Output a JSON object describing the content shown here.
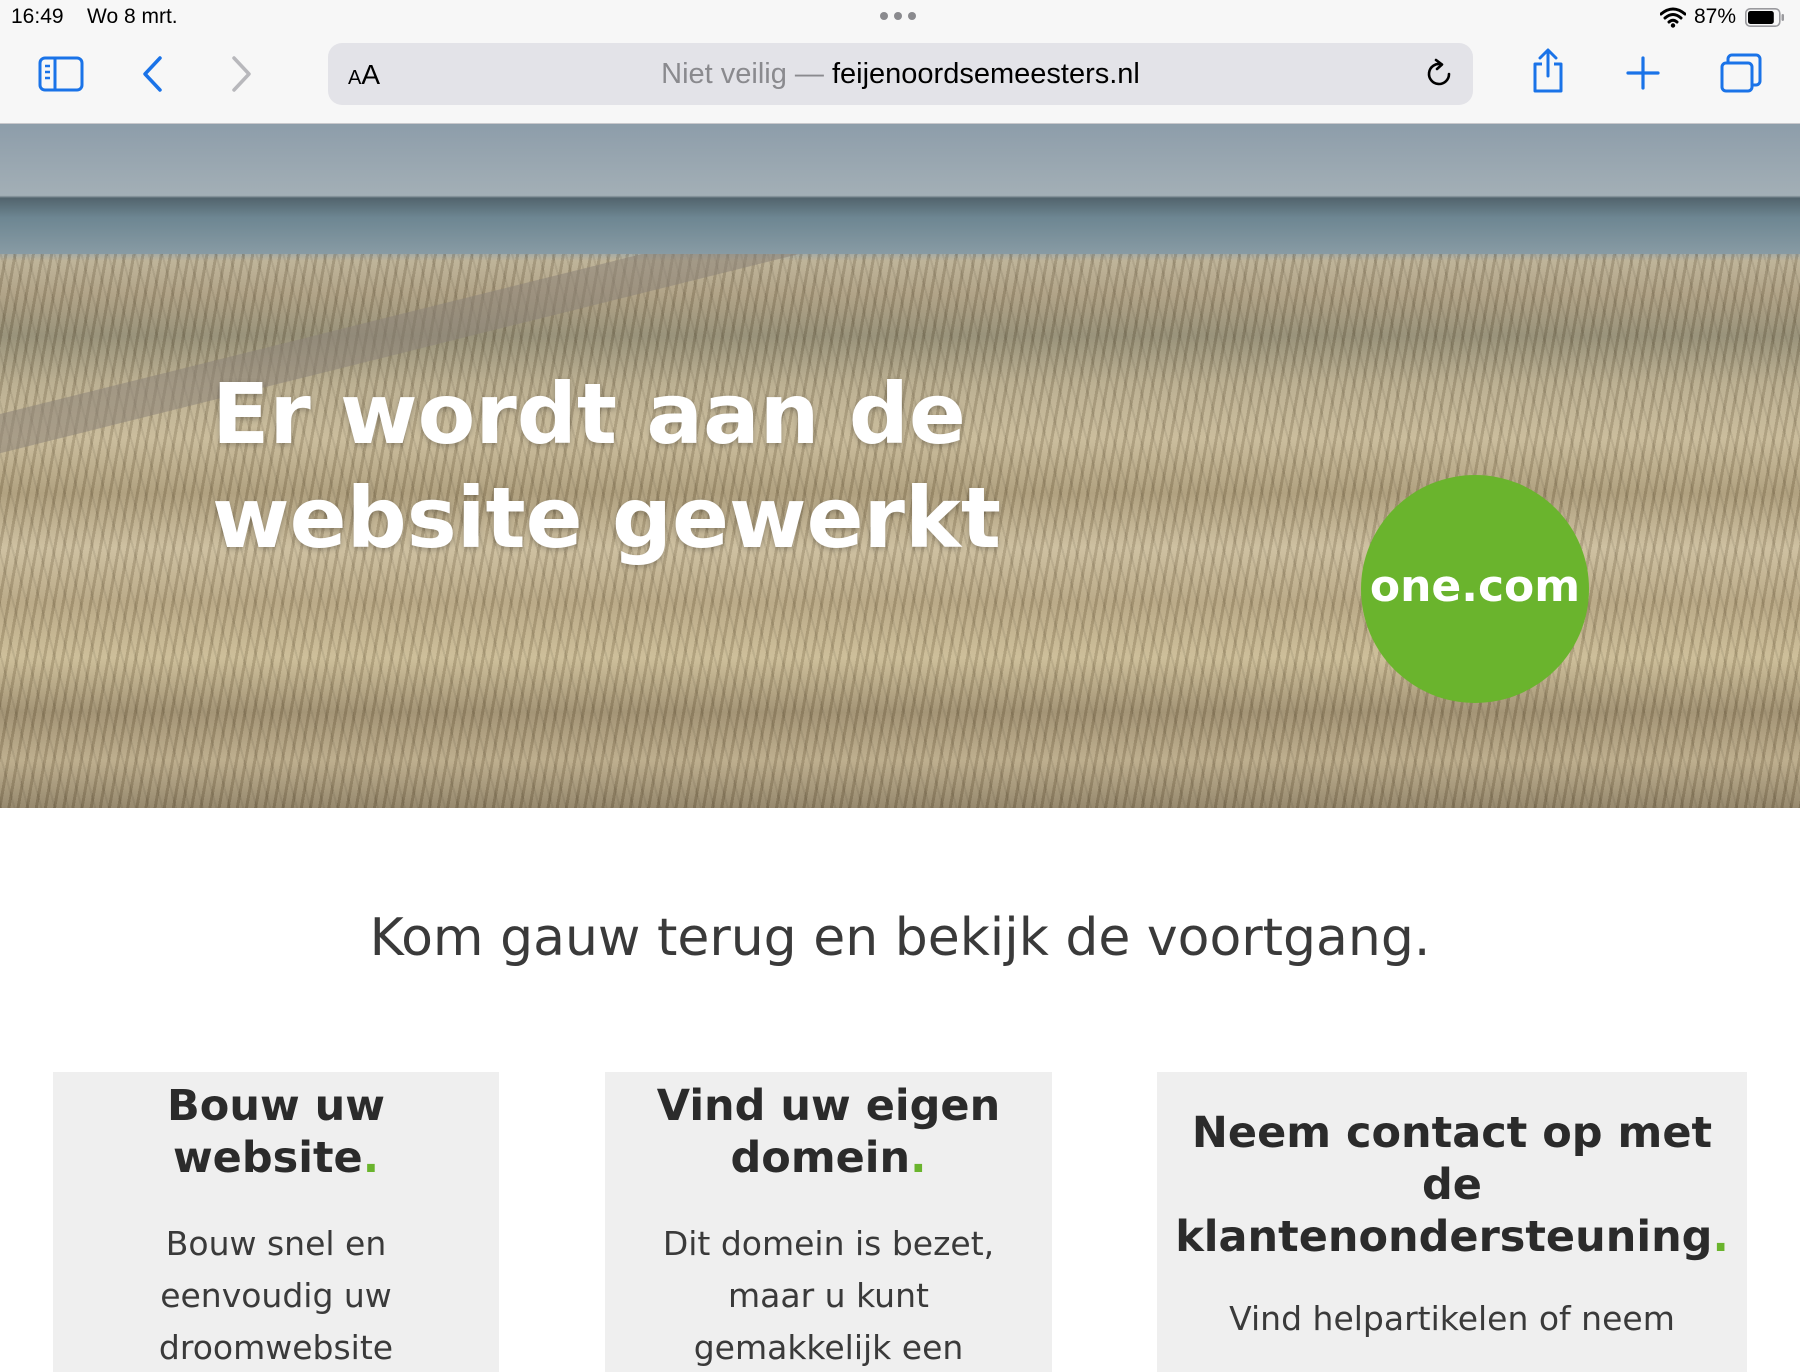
{
  "status_bar": {
    "time": "16:49",
    "date": "Wo 8 mrt.",
    "battery_percent": "87%",
    "battery_level": 0.87,
    "icons": [
      "multitask-dots-icon",
      "wifi-icon",
      "battery-icon"
    ]
  },
  "toolbar": {
    "icons": [
      "sidebar-icon",
      "back-icon",
      "forward-icon",
      "reload-icon",
      "share-icon",
      "new-tab-icon",
      "tabs-icon"
    ],
    "reader_small": "A",
    "reader_big": "A",
    "address": {
      "insecure_label": "Niet veilig",
      "separator": "—",
      "domain": "feijenoordsemeesters.nl"
    }
  },
  "hero": {
    "title_line1": "Er wordt aan de",
    "title_line2": "website gewerkt",
    "logo_left": "one",
    "logo_dot": ".",
    "logo_right": "com"
  },
  "content": {
    "subtitle": "Kom gauw terug en bekijk de voortgang.",
    "cards": [
      {
        "title_line1": "Bouw uw",
        "title_line2": "website",
        "dot": ".",
        "text_line1": "Bouw snel en",
        "text_line2": "eenvoudig uw",
        "text_line3": "droomwebsite"
      },
      {
        "title_line1": "Vind uw eigen",
        "title_line2": "domein",
        "dot": ".",
        "text_line1": "Dit domein is bezet,",
        "text_line2": "maar u kunt",
        "text_line3": "gemakkelijk een"
      },
      {
        "title_line1": "Neem contact op met",
        "title_line2": "de",
        "title_line3": "klantenondersteuning",
        "dot": ".",
        "text_line1": "Vind helpartikelen of neem"
      }
    ]
  },
  "colors": {
    "accent_green": "#6ab42d",
    "safari_blue": "#1a73e8",
    "toolbar_bg": "#f7f7f7",
    "card_bg": "#efefef"
  }
}
